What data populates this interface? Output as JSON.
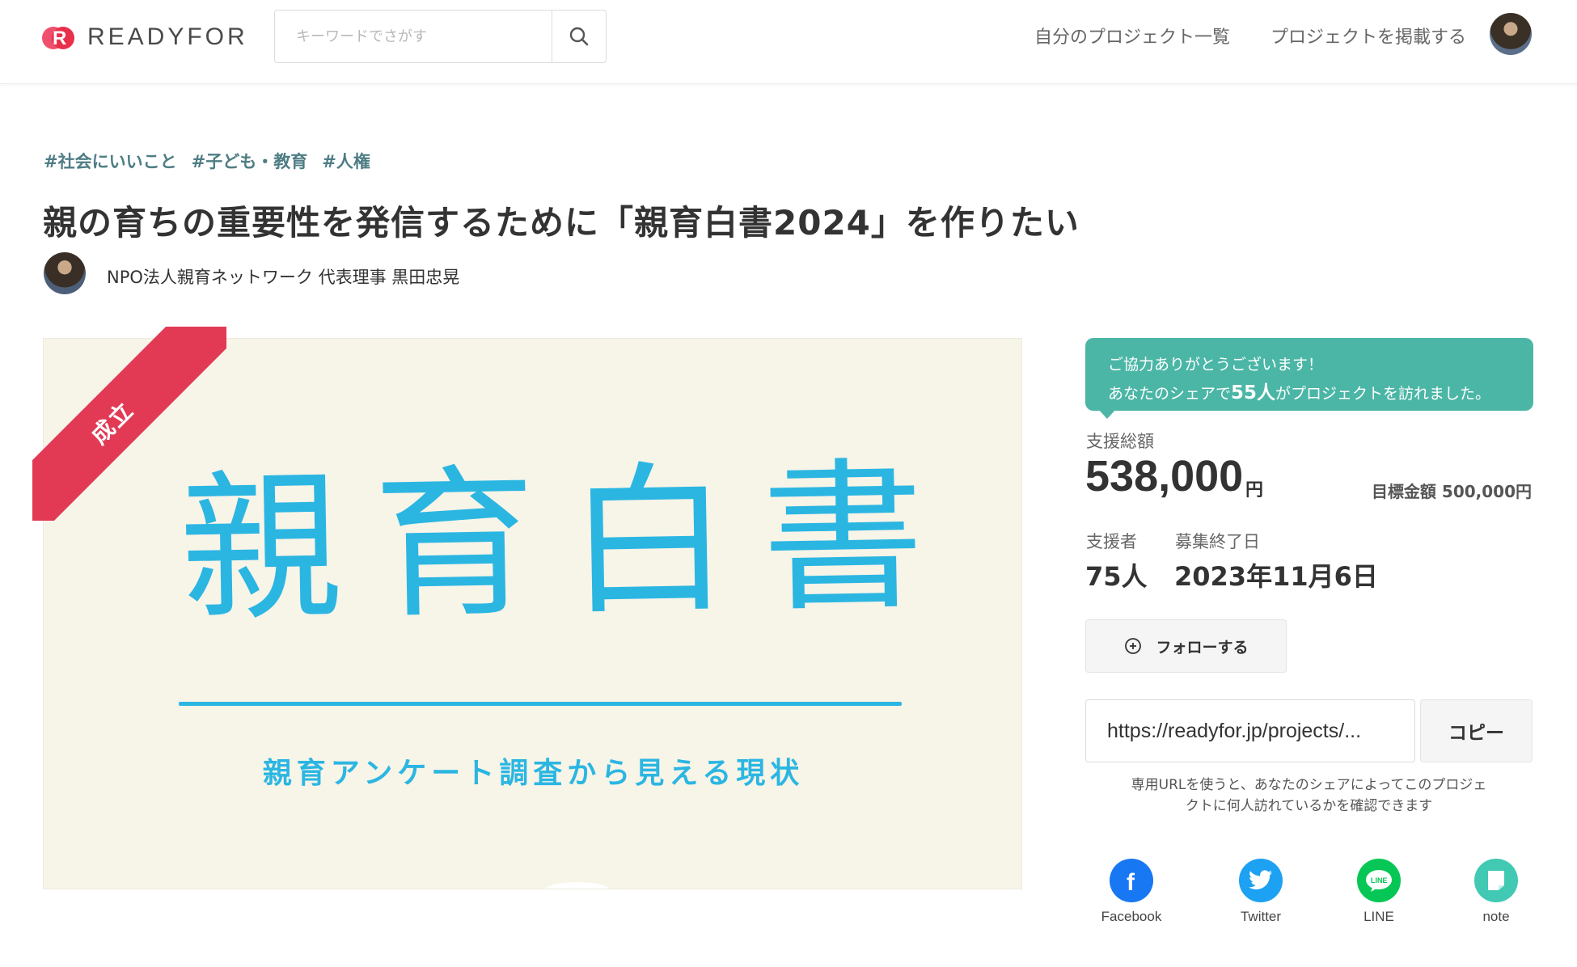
{
  "header": {
    "logo_text": "READYFOR",
    "logo_mark_letter": "R",
    "search_placeholder": "キーワードでさがす",
    "nav_my_projects": "自分のプロジェクト一覧",
    "nav_post_project": "プロジェクトを掲載する"
  },
  "project": {
    "tags": [
      "#社会にいいこと",
      "#子ども・教育",
      "#人権"
    ],
    "title": "親の育ちの重要性を発信するために「親育白書2024」を作りたい",
    "owner": "NPO法人親育ネットワーク 代表理事 黒田忠晃"
  },
  "hero": {
    "badge": "成立",
    "title": "親育白書",
    "subtitle": "親育アンケート調査から見える現状"
  },
  "panel": {
    "thanks_line1": "ご協力ありがとうございます！",
    "thanks_prefix": "あなたのシェアで",
    "thanks_count": "55人",
    "thanks_suffix": "がプロジェクトを訪れました。",
    "total_label": "支援総額",
    "total_amount": "538,000",
    "total_unit": "円",
    "goal": "目標金額 500,000円",
    "backers_label": "支援者",
    "backers_value": "75人",
    "end_label": "募集終了日",
    "end_value": "2023年11月6日",
    "follow_label": "フォローする",
    "share_url": "https://readyfor.jp/projects/...",
    "copy_label": "コピー",
    "url_note_line1": "専用URLを使うと、あなたのシェアによってこのプロジェ",
    "url_note_line2": "クトに何人訪れているかを確認できます"
  },
  "share_buttons": [
    {
      "label": "Facebook",
      "icon": "facebook-icon",
      "color": "#1877f2"
    },
    {
      "label": "Twitter",
      "icon": "twitter-icon",
      "color": "#1da1f2"
    },
    {
      "label": "LINE",
      "icon": "line-icon",
      "color": "#06c755"
    },
    {
      "label": "note",
      "icon": "note-icon",
      "color": "#41c9b4"
    }
  ],
  "colors": {
    "brand": "#e8304a",
    "accent_teal": "#4bb6a6",
    "tag": "#4e7d84",
    "hero_blue": "#2bb6e2",
    "ribbon": "#e23a55"
  }
}
